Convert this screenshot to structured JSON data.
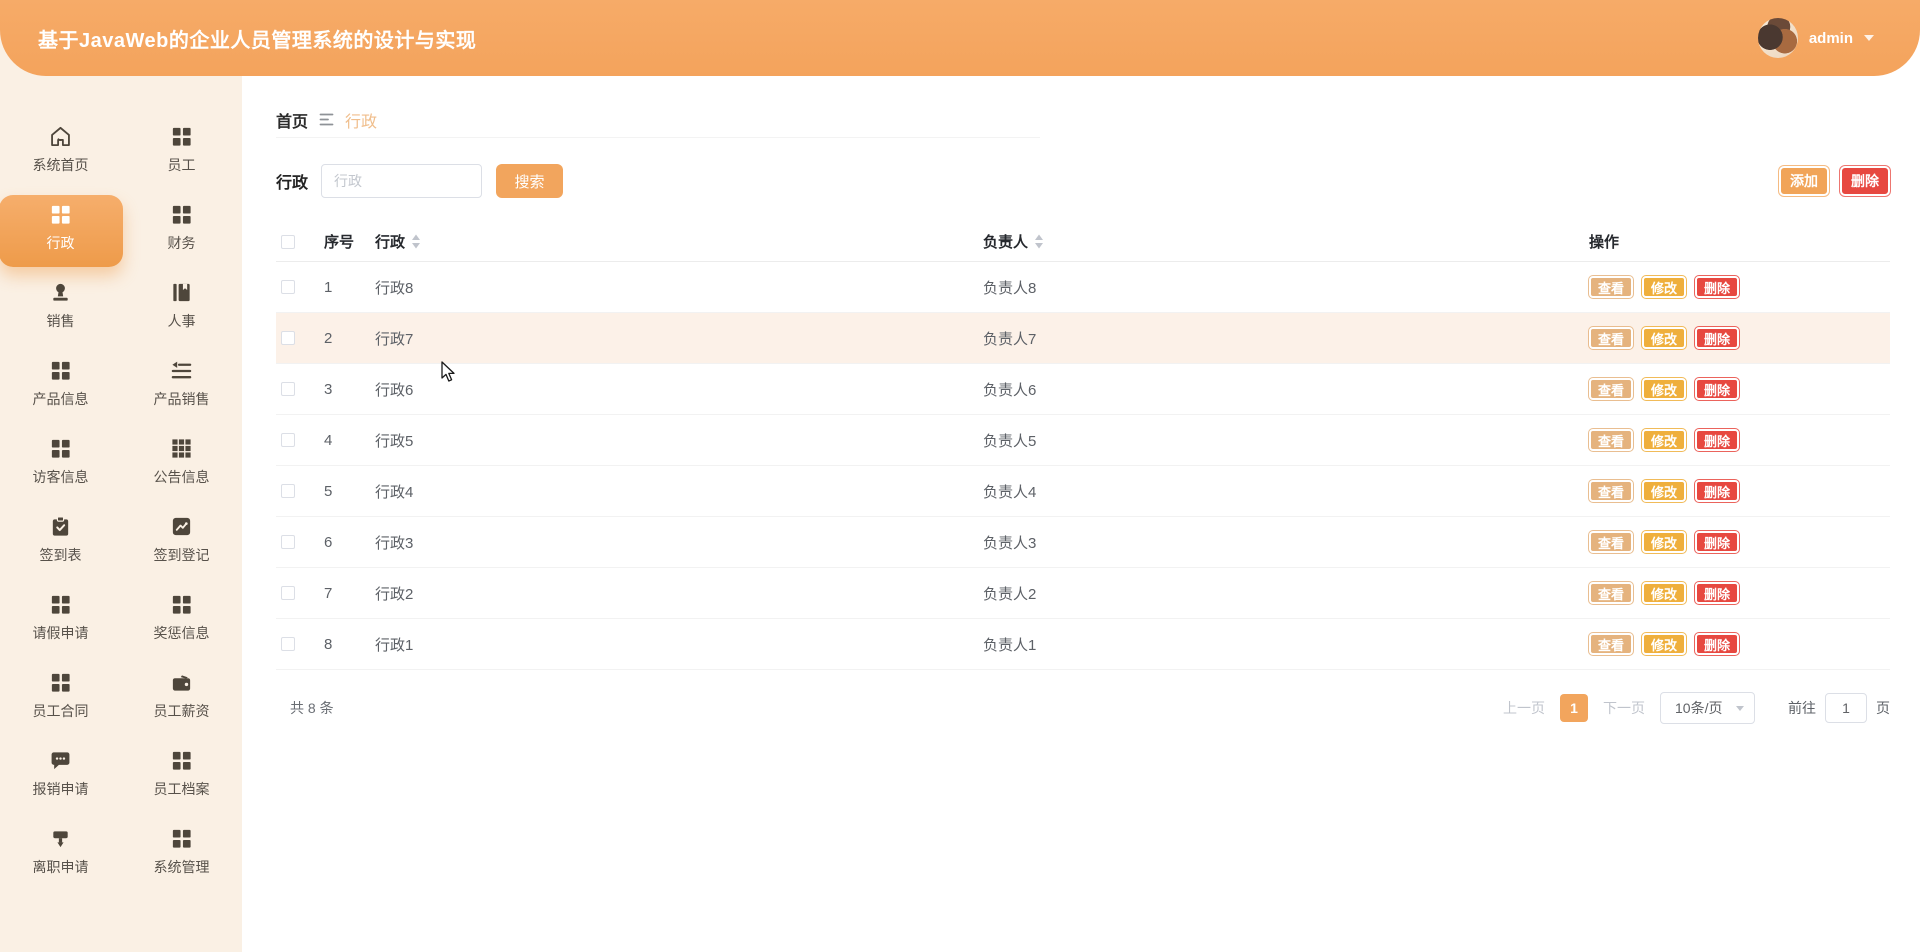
{
  "header": {
    "title": "基于JavaWeb的企业人员管理系统的设计与实现",
    "user": {
      "name": "admin"
    }
  },
  "sidebar": {
    "items": [
      {
        "key": "system-home",
        "label": "系统首页",
        "icon": "home",
        "active": false
      },
      {
        "key": "employee",
        "label": "员工",
        "icon": "grid",
        "active": false
      },
      {
        "key": "administration",
        "label": "行政",
        "icon": "grid",
        "active": true
      },
      {
        "key": "finance",
        "label": "财务",
        "icon": "grid",
        "active": false
      },
      {
        "key": "sales",
        "label": "销售",
        "icon": "stamp",
        "active": false
      },
      {
        "key": "hr",
        "label": "人事",
        "icon": "book",
        "active": false
      },
      {
        "key": "product-info",
        "label": "产品信息",
        "icon": "grid",
        "active": false
      },
      {
        "key": "product-sales",
        "label": "产品销售",
        "icon": "indent-list",
        "active": false
      },
      {
        "key": "visitor-info",
        "label": "访客信息",
        "icon": "grid",
        "active": false
      },
      {
        "key": "notice-info",
        "label": "公告信息",
        "icon": "grid-dense",
        "active": false
      },
      {
        "key": "checkin-sheet",
        "label": "签到表",
        "icon": "clipboard-check",
        "active": false
      },
      {
        "key": "checkin-register",
        "label": "签到登记",
        "icon": "chart-line",
        "active": false
      },
      {
        "key": "leave-request",
        "label": "请假申请",
        "icon": "grid",
        "active": false
      },
      {
        "key": "reward-punishment",
        "label": "奖惩信息",
        "icon": "grid",
        "active": false
      },
      {
        "key": "employee-contract",
        "label": "员工合同",
        "icon": "grid",
        "active": false
      },
      {
        "key": "employee-salary",
        "label": "员工薪资",
        "icon": "wallet",
        "active": false
      },
      {
        "key": "reimbursement-request",
        "label": "报销申请",
        "icon": "chat",
        "active": false
      },
      {
        "key": "employee-archive",
        "label": "员工档案",
        "icon": "grid",
        "active": false
      },
      {
        "key": "resignation-request",
        "label": "离职申请",
        "icon": "funnel",
        "active": false
      },
      {
        "key": "system-management",
        "label": "系统管理",
        "icon": "grid",
        "active": false
      }
    ]
  },
  "breadcrumb": {
    "home": "首页",
    "current": "行政"
  },
  "search": {
    "label": "行政",
    "placeholder": "行政",
    "button": "搜索"
  },
  "toolbar": {
    "add": "添加",
    "delete": "删除"
  },
  "table": {
    "columns": {
      "index": "序号",
      "name": "行政",
      "owner": "负责人",
      "actions": "操作"
    },
    "actions": {
      "view": "查看",
      "edit": "修改",
      "delete": "删除"
    },
    "rows": [
      {
        "index": "1",
        "name": "行政8",
        "owner": "负责人8",
        "hovered": false
      },
      {
        "index": "2",
        "name": "行政7",
        "owner": "负责人7",
        "hovered": true
      },
      {
        "index": "3",
        "name": "行政6",
        "owner": "负责人6",
        "hovered": false
      },
      {
        "index": "4",
        "name": "行政5",
        "owner": "负责人5",
        "hovered": false
      },
      {
        "index": "5",
        "name": "行政4",
        "owner": "负责人4",
        "hovered": false
      },
      {
        "index": "6",
        "name": "行政3",
        "owner": "负责人3",
        "hovered": false
      },
      {
        "index": "7",
        "name": "行政2",
        "owner": "负责人2",
        "hovered": false
      },
      {
        "index": "8",
        "name": "行政1",
        "owner": "负责人1",
        "hovered": false
      }
    ]
  },
  "pagination": {
    "total": "共 8 条",
    "prev": "上一页",
    "current_page": "1",
    "next": "下一页",
    "page_size": "10条/页",
    "goto_label": "前往",
    "goto_value": "1",
    "page_unit": "页"
  },
  "colors": {
    "header_bg": "#F5A761",
    "sidebar_bg": "#FAF0E4",
    "accent": "#F2A55D",
    "danger": "#E74840",
    "warning": "#EFAF3C",
    "view_btn": "#E5B37E",
    "row_hover": "#FCF1E8",
    "breadcrumb_current": "#F0BE8C"
  }
}
